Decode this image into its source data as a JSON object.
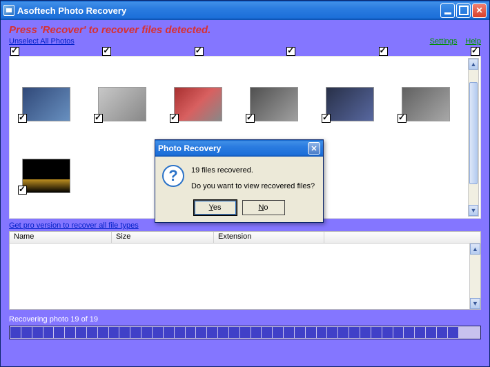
{
  "window": {
    "title": "Asoftech Photo Recovery"
  },
  "header": {
    "press_label": "Press 'Recover' to recover files detected.",
    "unselect_link": "Unselect All Photos",
    "settings_link": "Settings",
    "help_link": "Help"
  },
  "pro_link": "Get pro version to recover all file types",
  "table": {
    "col_name": "Name",
    "col_size": "Size",
    "col_ext": "Extension"
  },
  "status": {
    "text": "Recovering photo 19 of 19",
    "segments": 43,
    "filled": 41
  },
  "dialog": {
    "title": "Photo Recovery",
    "line1": "19 files recovered.",
    "line2": "Do you want to view recovered files?",
    "yes": "Yes",
    "no": "No"
  },
  "thumbs": {
    "row1_count": 6,
    "row2_count": 1
  }
}
